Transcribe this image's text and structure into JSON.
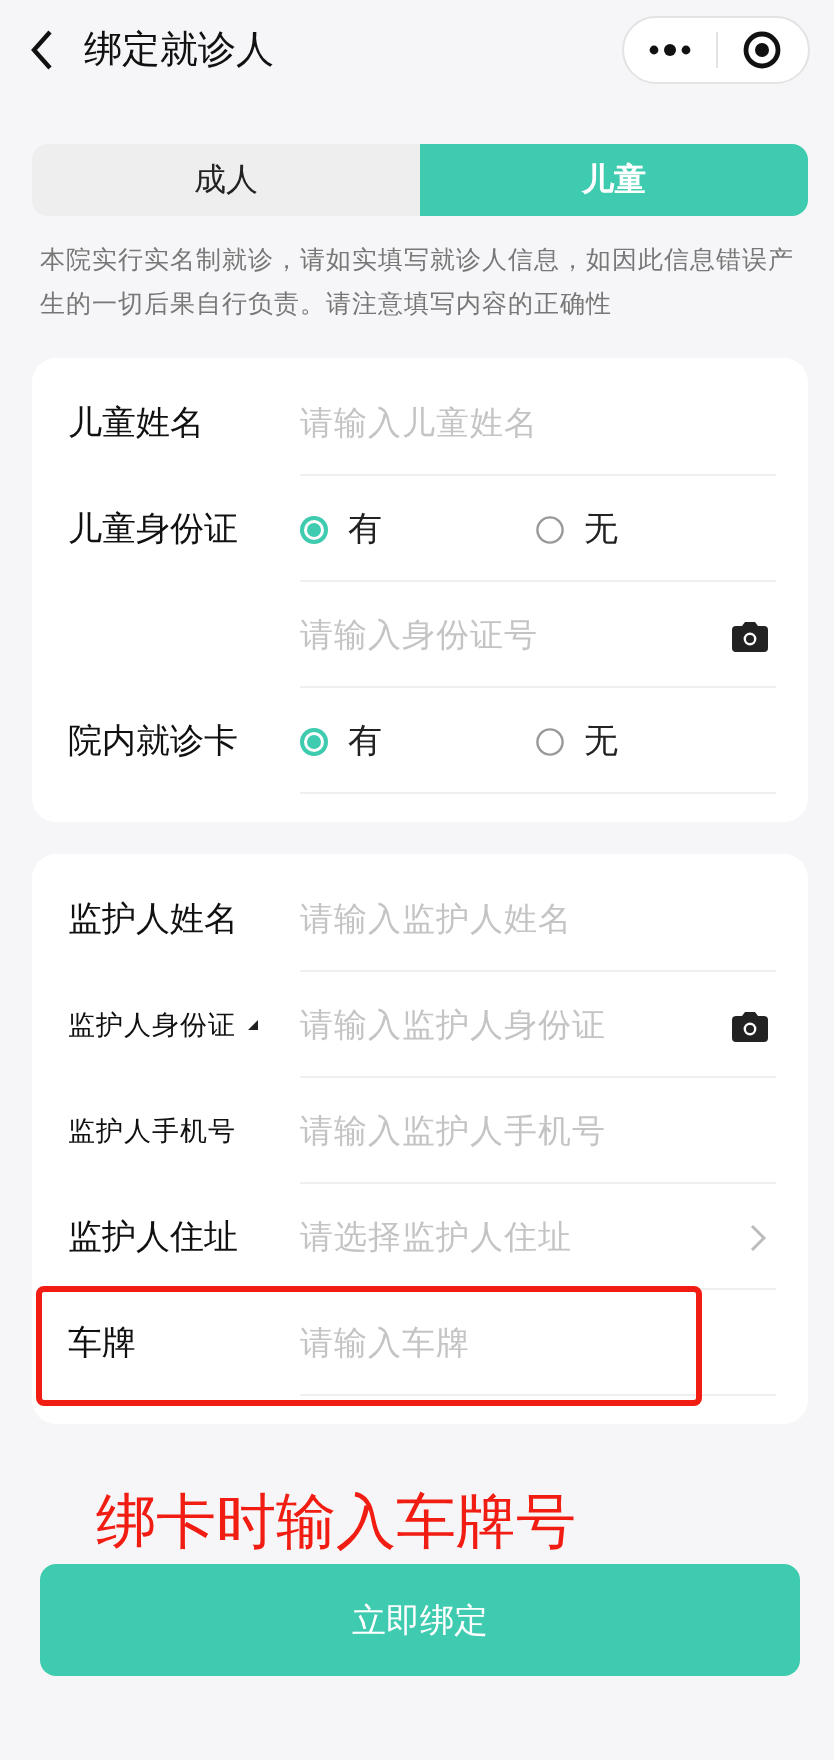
{
  "header": {
    "title": "绑定就诊人"
  },
  "tabs": [
    {
      "label": "成人",
      "selected": false
    },
    {
      "label": "儿童",
      "selected": true
    }
  ],
  "notice": "本院实行实名制就诊，请如实填写就诊人信息，如因此信息错误产生的一切后果自行负责。请注意填写内容的正确性",
  "sections": [
    {
      "rows": [
        {
          "kind": "input",
          "label": "儿童姓名",
          "placeholder": "请输入儿童姓名"
        },
        {
          "kind": "radio",
          "label": "儿童身份证",
          "options": [
            {
              "label": "有",
              "selected": true
            },
            {
              "label": "无",
              "selected": false
            }
          ]
        },
        {
          "kind": "input",
          "placeholder": "请输入身份证号",
          "camera": true
        },
        {
          "kind": "radio",
          "label": "院内就诊卡",
          "options": [
            {
              "label": "有",
              "selected": true
            },
            {
              "label": "无",
              "selected": false
            }
          ]
        }
      ]
    },
    {
      "rows": [
        {
          "kind": "input",
          "label": "监护人姓名",
          "placeholder": "请输入监护人姓名"
        },
        {
          "kind": "input",
          "label": "监护人身份证",
          "dropdown": true,
          "placeholder": "请输入监护人身份证",
          "camera": true
        },
        {
          "kind": "input",
          "label": "监护人手机号",
          "placeholder": "请输入监护人手机号"
        },
        {
          "kind": "select",
          "label": "监护人住址",
          "placeholder": "请选择监护人住址"
        },
        {
          "kind": "input",
          "label": "车牌",
          "placeholder": "请输入车牌",
          "highlighted": true
        }
      ]
    }
  ],
  "annotation": "绑卡时输入车牌号",
  "submit": "立即绑定"
}
